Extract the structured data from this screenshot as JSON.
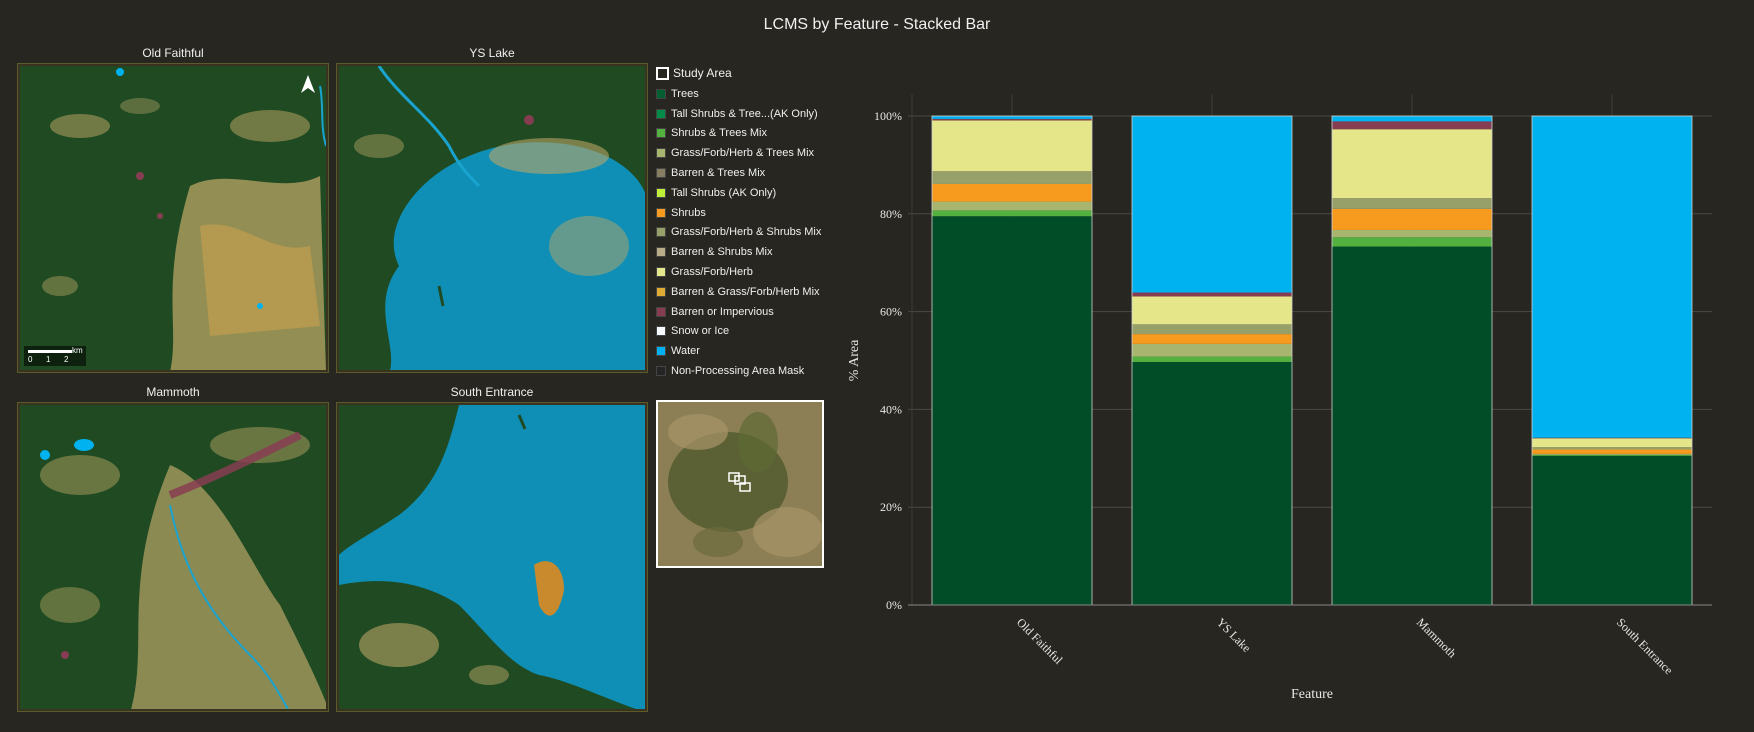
{
  "page": {
    "title": "LCMS by Feature - Stacked Bar"
  },
  "maps": [
    {
      "title": "Old Faithful"
    },
    {
      "title": "YS Lake"
    },
    {
      "title": "Mammoth"
    },
    {
      "title": "South Entrance"
    }
  ],
  "scalebar": {
    "unit": "km",
    "ticks": [
      "0",
      "1",
      "2"
    ]
  },
  "legend": {
    "header": "Study Area",
    "items": [
      {
        "label": "Trees",
        "color": "#005e30"
      },
      {
        "label": "Tall Shrubs & Tree...(AK Only)",
        "color": "#008b46"
      },
      {
        "label": "Shrubs & Trees Mix",
        "color": "#54b140"
      },
      {
        "label": "Grass/Forb/Herb & Trees Mix",
        "color": "#a7b56e"
      },
      {
        "label": "Barren & Trees Mix",
        "color": "#857e60"
      },
      {
        "label": "Tall Shrubs (AK Only)",
        "color": "#c0f03a"
      },
      {
        "label": "Shrubs",
        "color": "#f79b1f"
      },
      {
        "label": "Grass/Forb/Herb & Shrubs Mix",
        "color": "#98a06a"
      },
      {
        "label": "Barren & Shrubs Mix",
        "color": "#b8ad88"
      },
      {
        "label": "Grass/Forb/Herb",
        "color": "#e5e58a"
      },
      {
        "label": "Barren & Grass/Forb/Herb Mix",
        "color": "#dfac33"
      },
      {
        "label": "Barren or Impervious",
        "color": "#873d51"
      },
      {
        "label": "Snow or Ice",
        "color": "#f6faff"
      },
      {
        "label": "Water",
        "color": "#00b3f0"
      },
      {
        "label": "Non-Processing Area Mask",
        "color": "#252525"
      }
    ]
  },
  "chart_data": {
    "type": "bar",
    "stacked": true,
    "title": "",
    "xlabel": "Feature",
    "ylabel": "% Area",
    "ylim": [
      0,
      100
    ],
    "yticks": [
      "0%",
      "20%",
      "40%",
      "60%",
      "80%",
      "100%"
    ],
    "categories": [
      "Old Faithful",
      "YS Lake",
      "Mammoth",
      "South Entrance"
    ],
    "grid": true,
    "series": [
      {
        "color": "#004d28",
        "values": [
          79.5,
          49.7,
          73.3,
          30.5
        ]
      },
      {
        "color": "#54b140",
        "values": [
          1.2,
          1.1,
          1.9,
          0.2
        ]
      },
      {
        "color": "#a7b56e",
        "values": [
          1.8,
          2.6,
          1.5,
          0.2
        ]
      },
      {
        "color": "#f79b1f",
        "values": [
          3.6,
          2.0,
          4.3,
          0.9
        ]
      },
      {
        "color": "#98a06a",
        "values": [
          2.6,
          2.0,
          2.2,
          0.5
        ]
      },
      {
        "color": "#e5e58a",
        "values": [
          10.4,
          5.7,
          14.1,
          1.8
        ]
      },
      {
        "color": "#873d51",
        "values": [
          0.3,
          0.8,
          1.6,
          0.1
        ]
      },
      {
        "color": "#00b3f0",
        "values": [
          0.6,
          36.1,
          1.1,
          65.8
        ]
      }
    ]
  }
}
